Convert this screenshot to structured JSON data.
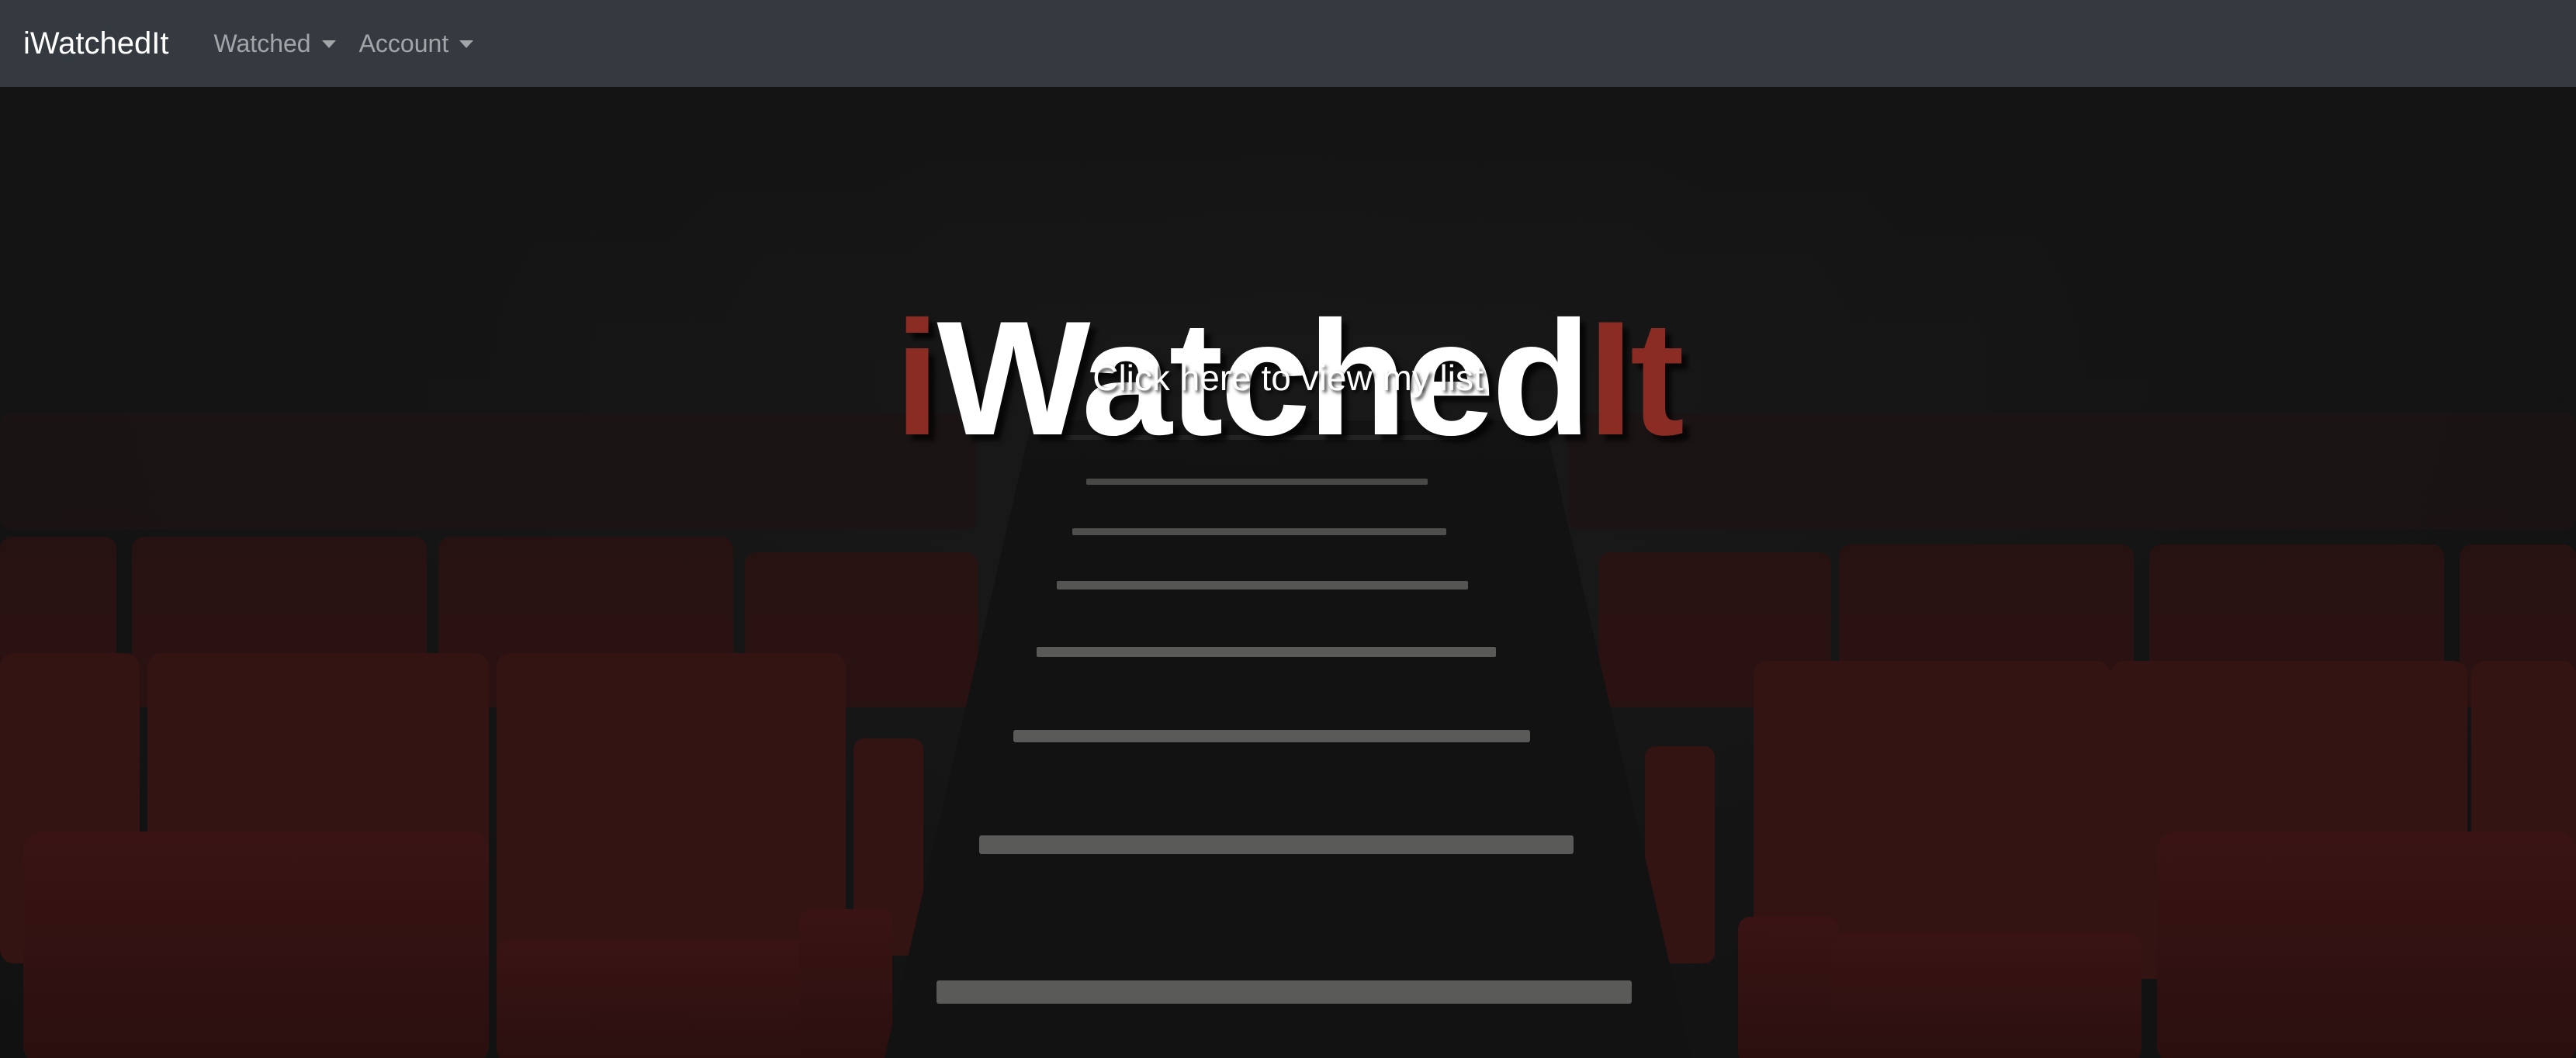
{
  "navbar": {
    "brand": "iWatchedIt",
    "items": [
      {
        "label": "Watched"
      },
      {
        "label": "Account"
      }
    ]
  },
  "hero": {
    "title_pre": "i",
    "title_main": "Watched",
    "title_accent": "It",
    "link_text": "Click here to view my list"
  },
  "colors": {
    "navbar_bg": "#343a40",
    "accent_red": "#8a2b24",
    "background": "#141414"
  }
}
